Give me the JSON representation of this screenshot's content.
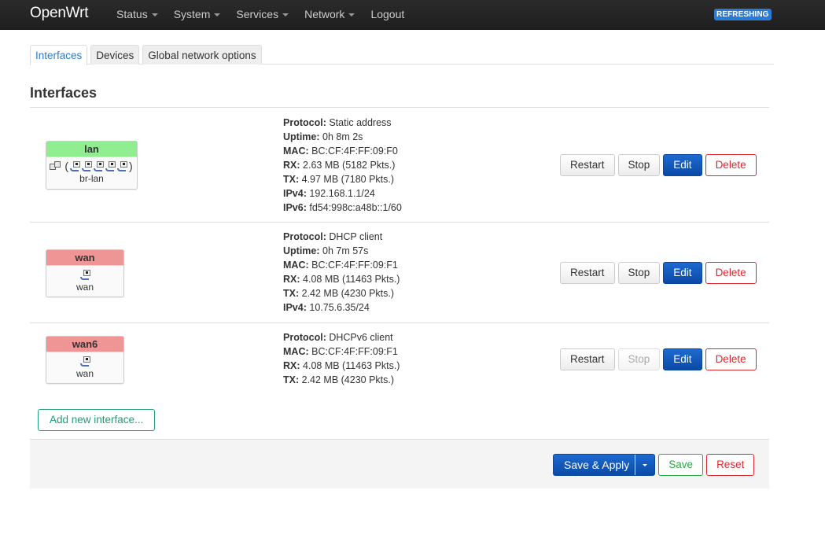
{
  "navbar": {
    "brand": "OpenWrt",
    "menu": [
      {
        "label": "Status",
        "dropdown": true
      },
      {
        "label": "System",
        "dropdown": true
      },
      {
        "label": "Services",
        "dropdown": true
      },
      {
        "label": "Network",
        "dropdown": true
      },
      {
        "label": "Logout",
        "dropdown": false
      }
    ],
    "status_badge": "REFRESHING"
  },
  "tabs": [
    {
      "label": "Interfaces",
      "active": true
    },
    {
      "label": "Devices",
      "active": false
    },
    {
      "label": "Global network options",
      "active": false
    }
  ],
  "section_title": "Interfaces",
  "interfaces": [
    {
      "name": "lan",
      "status_color": "#90ee90",
      "device": "br-lan",
      "bridge": true,
      "port_count": 5,
      "details": [
        {
          "label": "Protocol:",
          "value": "Static address"
        },
        {
          "label": "Uptime:",
          "value": "0h 8m 2s"
        },
        {
          "label": "MAC:",
          "value": "BC:CF:4F:FF:09:F0"
        },
        {
          "label": "RX:",
          "value": "2.63 MB (5182 Pkts.)"
        },
        {
          "label": "TX:",
          "value": "4.97 MB (7180 Pkts.)"
        },
        {
          "label": "IPv4:",
          "value": "192.168.1.1/24"
        },
        {
          "label": "IPv6:",
          "value": "fd54:998c:a48b::1/60"
        }
      ],
      "actions": {
        "restart": "Restart",
        "stop": "Stop",
        "stop_disabled": false,
        "edit": "Edit",
        "delete": "Delete"
      }
    },
    {
      "name": "wan",
      "status_color": "#f09595",
      "device": "wan",
      "bridge": false,
      "port_count": 1,
      "details": [
        {
          "label": "Protocol:",
          "value": "DHCP client"
        },
        {
          "label": "Uptime:",
          "value": "0h 7m 57s"
        },
        {
          "label": "MAC:",
          "value": "BC:CF:4F:FF:09:F1"
        },
        {
          "label": "RX:",
          "value": "4.08 MB (11463 Pkts.)"
        },
        {
          "label": "TX:",
          "value": "2.42 MB (4230 Pkts.)"
        },
        {
          "label": "IPv4:",
          "value": "10.75.6.35/24"
        }
      ],
      "actions": {
        "restart": "Restart",
        "stop": "Stop",
        "stop_disabled": false,
        "edit": "Edit",
        "delete": "Delete"
      }
    },
    {
      "name": "wan6",
      "status_color": "#f09595",
      "device": "wan",
      "bridge": false,
      "port_count": 1,
      "details": [
        {
          "label": "Protocol:",
          "value": "DHCPv6 client"
        },
        {
          "label": "MAC:",
          "value": "BC:CF:4F:FF:09:F1"
        },
        {
          "label": "RX:",
          "value": "4.08 MB (11463 Pkts.)"
        },
        {
          "label": "TX:",
          "value": "2.42 MB (4230 Pkts.)"
        }
      ],
      "actions": {
        "restart": "Restart",
        "stop": "Stop",
        "stop_disabled": true,
        "edit": "Edit",
        "delete": "Delete"
      }
    }
  ],
  "add_interface_label": "Add new interface...",
  "footer": {
    "save_apply": "Save & Apply",
    "save": "Save",
    "reset": "Reset"
  }
}
